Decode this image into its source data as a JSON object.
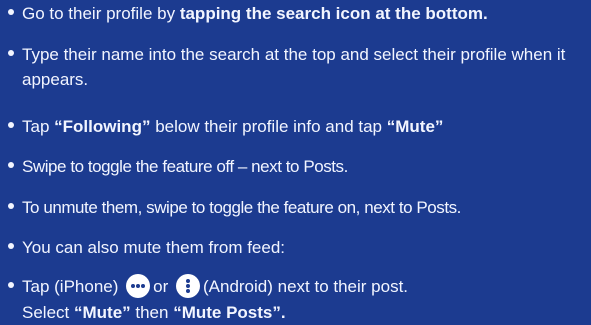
{
  "items": [
    {
      "pre": "Go to their profile by ",
      "bold": "tapping the search icon at the bottom."
    },
    {
      "text": "Type their name into the search at the top and select their profile when it appears."
    },
    {
      "pre": "Tap ",
      "bold1": "“Following”",
      "mid": " below their profile info and tap ",
      "bold2": "“Mute”"
    },
    {
      "text": "Swipe to toggle the feature off – next to Posts."
    },
    {
      "text": "To unmute them, swipe to toggle the feature on, next to Posts."
    },
    {
      "text": "You can also mute them from feed:"
    },
    {
      "pre": "Tap (iPhone)",
      "icon1": "more-horizontal-icon",
      "or": "or",
      "icon2": "more-vertical-icon",
      "post": "(Android) next to their post.",
      "line2_pre": "Select ",
      "bold1": "“Mute”",
      "line2_mid": " then ",
      "bold2": "“Mute Posts”."
    }
  ],
  "colors": {
    "background": "#1c3b90",
    "text": "#f2f5ff",
    "icon_bg": "#ffffff",
    "icon_fg": "#1c3b90"
  }
}
